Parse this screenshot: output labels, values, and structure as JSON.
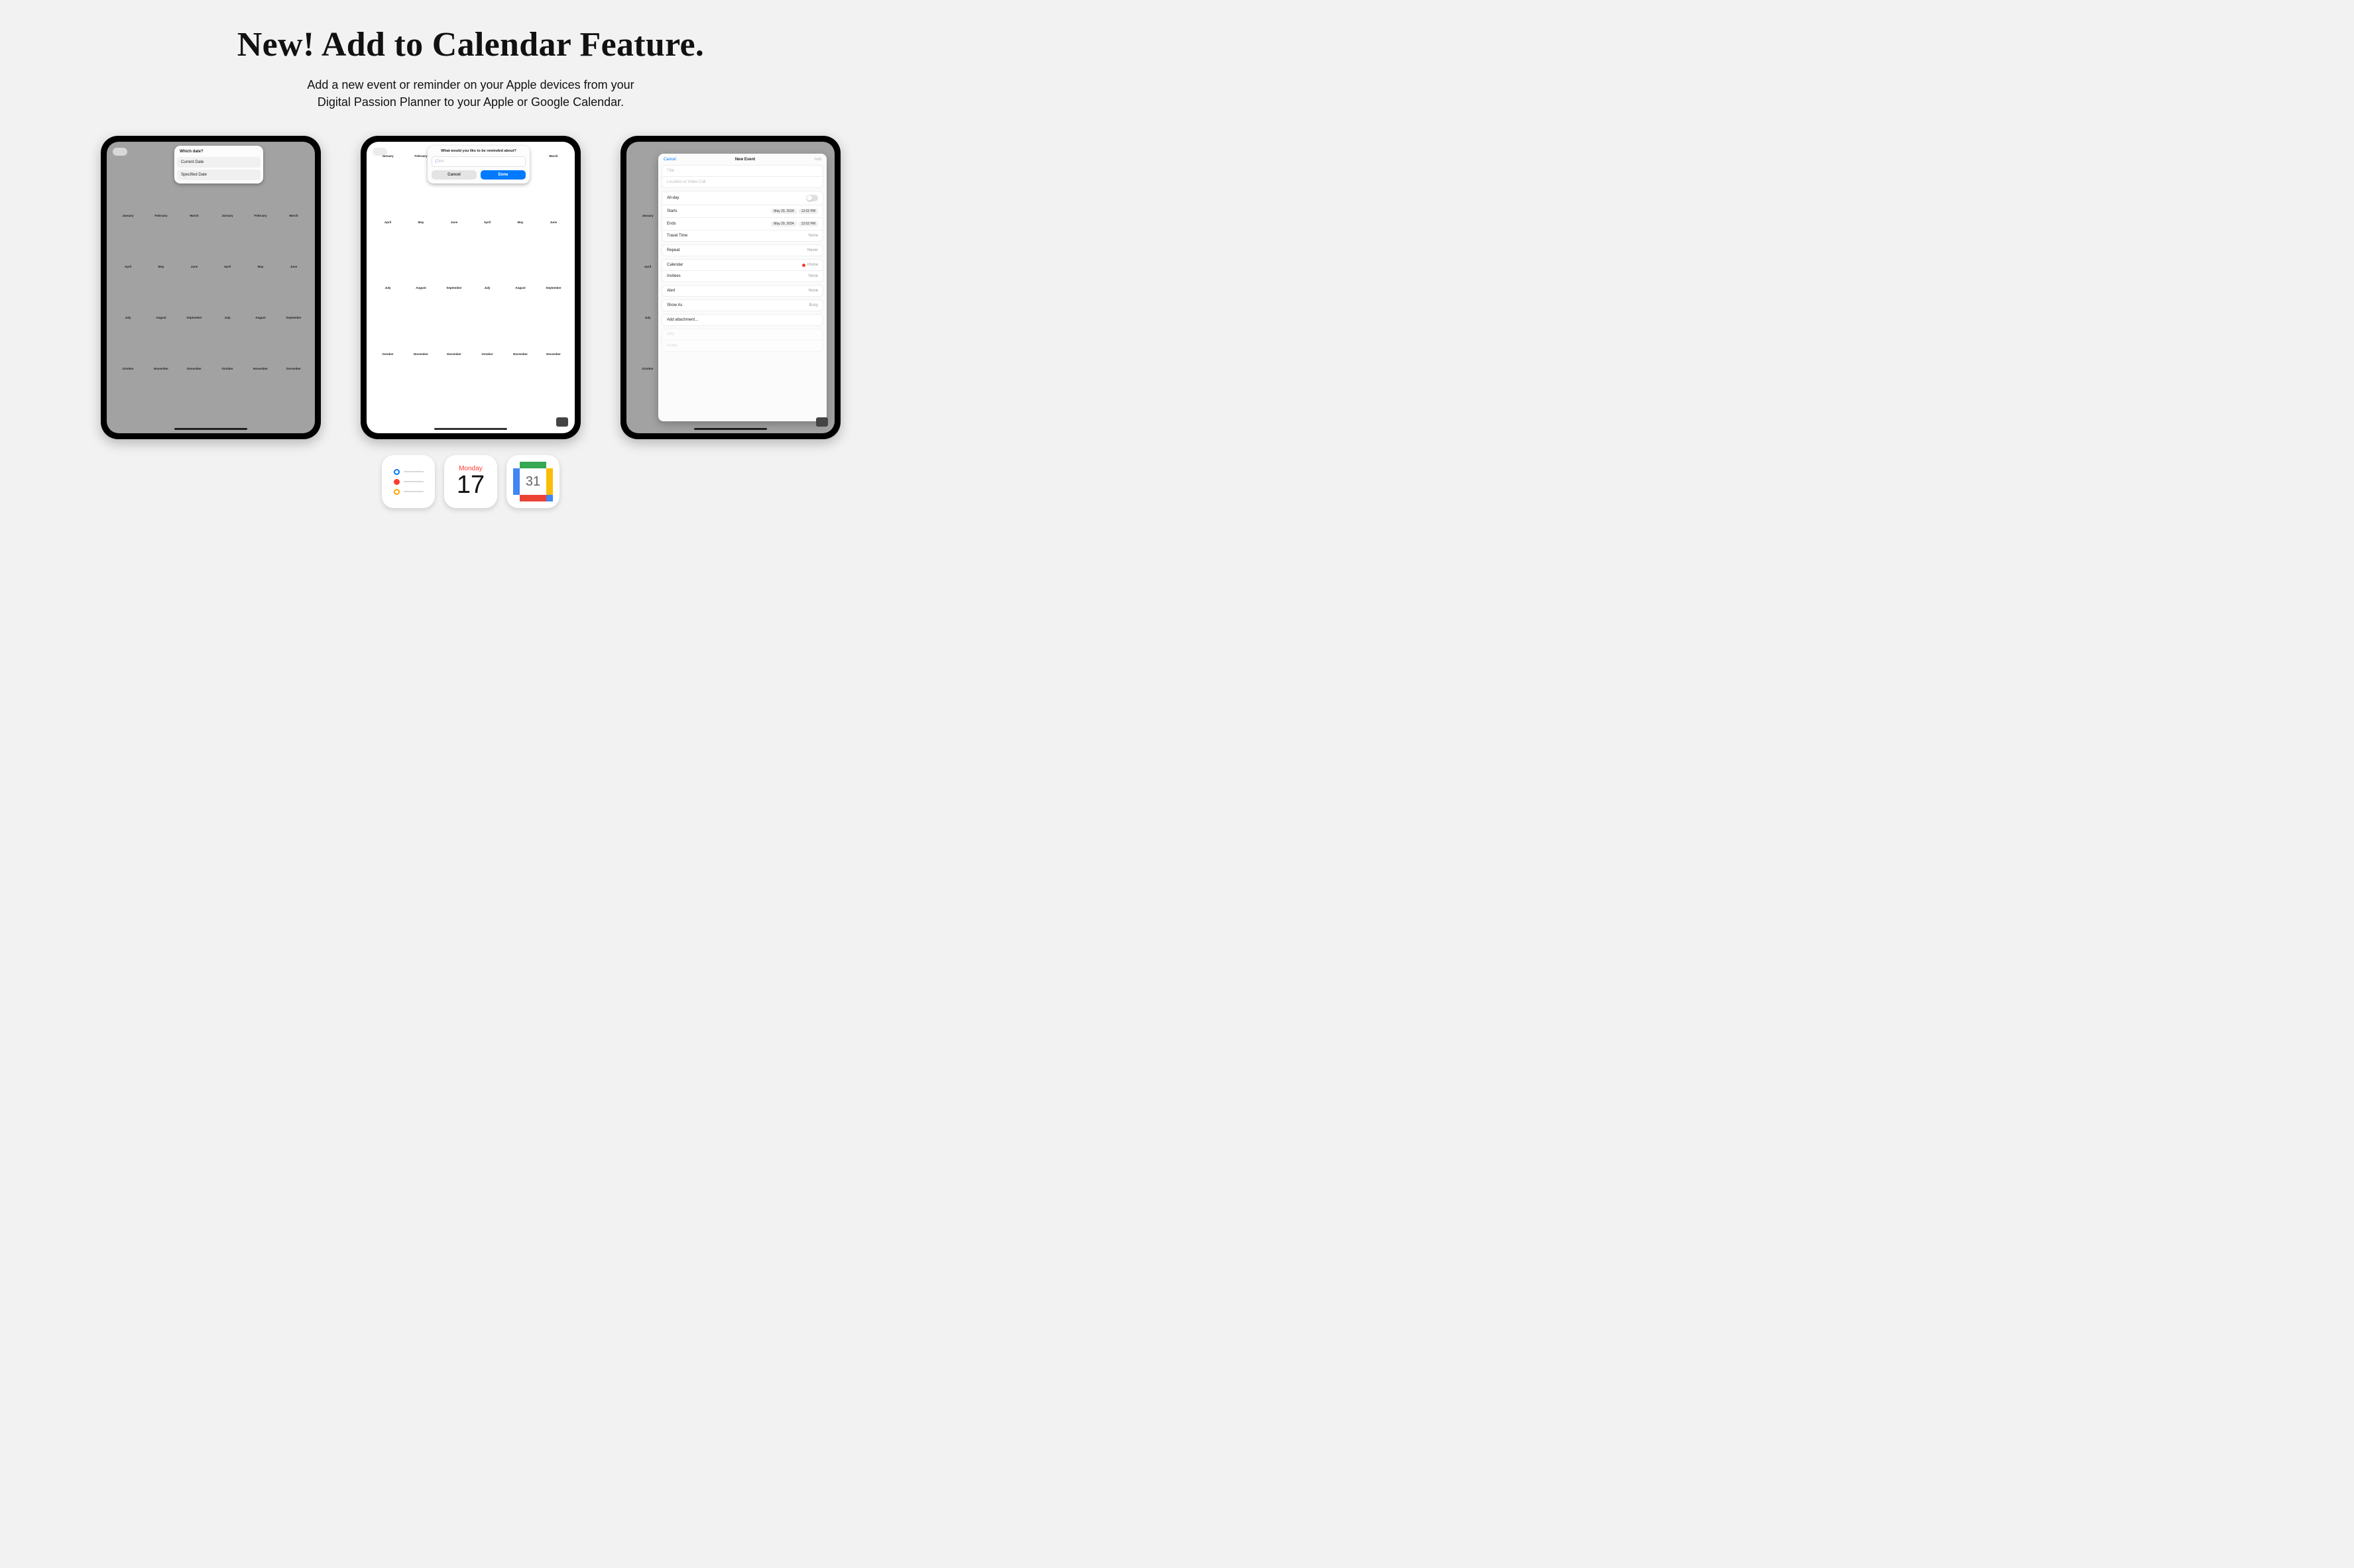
{
  "hero": {
    "title": "New! Add to Calendar Feature.",
    "subtitle_line1": "Add a new event or reminder on your Apple devices from your",
    "subtitle_line2": "Digital Passion Planner to your Apple or Google Calendar."
  },
  "ipad1": {
    "popover_title": "Which date?",
    "option_current": "Current Date",
    "option_specified": "Specified Date"
  },
  "ipad2": {
    "prompt_title": "What would you like to be reminded about?",
    "placeholder": "Text",
    "cancel": "Cancel",
    "done": "Done"
  },
  "ipad3": {
    "header_cancel": "Cancel",
    "header_title": "New Event",
    "header_add": "Add",
    "title_placeholder": "Title",
    "location_placeholder": "Location or Video Call",
    "allday_label": "All-day",
    "starts_label": "Starts",
    "starts_date": "May 29, 2024",
    "starts_time": "12:02 PM",
    "ends_label": "Ends",
    "ends_date": "May 29, 2024",
    "ends_time": "12:02 PM",
    "travel_label": "Travel Time",
    "travel_value": "None",
    "repeat_label": "Repeat",
    "repeat_value": "Never",
    "calendar_label": "Calendar",
    "calendar_value": "Home",
    "invitees_label": "Invitees",
    "invitees_value": "None",
    "alert_label": "Alert",
    "alert_value": "None",
    "showas_label": "Show As",
    "showas_value": "Busy",
    "attachment_label": "Add attachment...",
    "url_label": "URL",
    "notes_label": "Notes"
  },
  "months_row1": [
    "January",
    "February",
    "March",
    "January",
    "February",
    "March"
  ],
  "months_row2": [
    "April",
    "May",
    "June",
    "April",
    "May",
    "June"
  ],
  "months_row3": [
    "July",
    "August",
    "September",
    "July",
    "August",
    "September"
  ],
  "months_row4": [
    "October",
    "November",
    "December",
    "October",
    "November",
    "December"
  ],
  "apple_cal": {
    "day": "Monday",
    "num": "17"
  },
  "gcal": {
    "num": "31"
  }
}
